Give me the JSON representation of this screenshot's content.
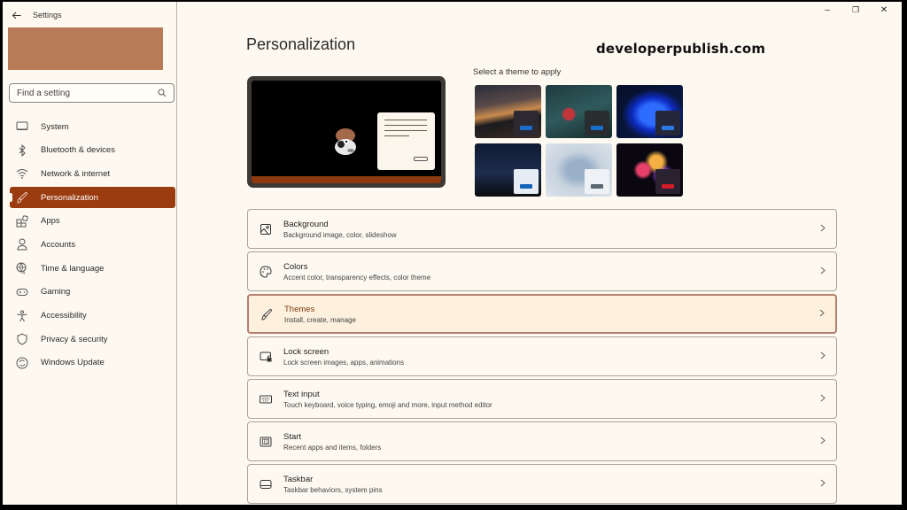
{
  "window": {
    "title": "Settings",
    "controls": {
      "minimize": "–",
      "restore": "❐",
      "close": "✕"
    }
  },
  "sidebar": {
    "search_placeholder": "Find a setting",
    "items": [
      {
        "label": "System",
        "icon": "monitor-icon",
        "active": false
      },
      {
        "label": "Bluetooth & devices",
        "icon": "bluetooth-icon",
        "active": false
      },
      {
        "label": "Network & internet",
        "icon": "wifi-icon",
        "active": false
      },
      {
        "label": "Personalization",
        "icon": "brush-icon",
        "active": true
      },
      {
        "label": "Apps",
        "icon": "apps-icon",
        "active": false
      },
      {
        "label": "Accounts",
        "icon": "person-icon",
        "active": false
      },
      {
        "label": "Time & language",
        "icon": "globe-language-icon",
        "active": false
      },
      {
        "label": "Gaming",
        "icon": "gamepad-icon",
        "active": false
      },
      {
        "label": "Accessibility",
        "icon": "accessibility-icon",
        "active": false
      },
      {
        "label": "Privacy & security",
        "icon": "shield-icon",
        "active": false
      },
      {
        "label": "Windows Update",
        "icon": "update-icon",
        "active": false
      }
    ]
  },
  "main": {
    "title": "Personalization",
    "watermark": "developerpublish.com",
    "theme_section_label": "Select a theme to apply",
    "themes": [
      {
        "name": "theme-1",
        "bg": "linear-gradient(170deg,#2a2d3a 0%,#5a4a48 35%,#c98b4e 52%,#1b1b1f 65%,#3a2c22 100%)",
        "chip": "#2c2a30",
        "bar": "#1a6dc9"
      },
      {
        "name": "theme-2",
        "bg": "radial-gradient(circle at 35% 55%,#c2353a 0 10%,transparent 14%),linear-gradient(160deg,#1f3b3f 0%,#2f5a5c 50%,#162a2c 100%)",
        "chip": "#2a2d2f",
        "bar": "#1a6dc9"
      },
      {
        "name": "theme-3",
        "bg": "radial-gradient(ellipse at 55% 55%,#2d6cff 0 25%,#0d2bbf 40%,transparent 60%),linear-gradient(135deg,#06102a 0%,#0b1a4a 100%)",
        "chip": "#25283a",
        "bar": "#2a7ae6"
      },
      {
        "name": "theme-4",
        "bg": "linear-gradient(180deg,#0f1a33 0%,#1e2d4d 55%,#121a2a 80%,#0a0d12 100%)",
        "chip": "#e7edf5",
        "bar": "#1563b8"
      },
      {
        "name": "theme-5",
        "bg": "radial-gradient(ellipse at 50% 50%,#9ab0c8 0 25%,#c7d3df 50%,#dde3ea 100%)",
        "chip": "#eef1f5",
        "bar": "#5a6874"
      },
      {
        "name": "theme-6",
        "bg": "radial-gradient(circle at 40% 50%,#e8406a 0 12%,transparent 20%),radial-gradient(circle at 60% 35%,#f4b043 0 12%,transparent 22%),radial-gradient(circle at 70% 60%,#8a3fd6 0 10%,transparent 20%),#0a0710",
        "chip": "#2a2230",
        "bar": "#d21c2a"
      }
    ],
    "cards": [
      {
        "title": "Background",
        "subtitle": "Background image, color, slideshow",
        "icon": "image-icon",
        "active": false
      },
      {
        "title": "Colors",
        "subtitle": "Accent color, transparency effects, color theme",
        "icon": "palette-icon",
        "active": false
      },
      {
        "title": "Themes",
        "subtitle": "Install, create, manage",
        "icon": "brush-icon",
        "active": true
      },
      {
        "title": "Lock screen",
        "subtitle": "Lock screen images, apps, animations",
        "icon": "lock-screen-icon",
        "active": false
      },
      {
        "title": "Text input",
        "subtitle": "Touch keyboard, voice typing, emoji and more, input method editor",
        "icon": "keyboard-icon",
        "active": false
      },
      {
        "title": "Start",
        "subtitle": "Recent apps and items, folders",
        "icon": "start-icon",
        "active": false
      },
      {
        "title": "Taskbar",
        "subtitle": "Taskbar behaviors, system pins",
        "icon": "taskbar-icon",
        "active": false
      }
    ]
  },
  "colors": {
    "accent": "#9a3b10",
    "background": "#fdf9f0",
    "account_banner": "#b97a58"
  }
}
